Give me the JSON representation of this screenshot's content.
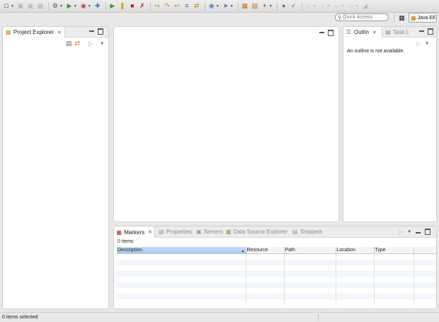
{
  "toolbar": {
    "quick_access_placeholder": "Quick Access",
    "perspective_label": "Java EE"
  },
  "project_explorer": {
    "tab_label": "Project Explorer"
  },
  "outline": {
    "tab_label": "Outlin",
    "task_tab_label": "Task L",
    "message": "An outline is not available."
  },
  "bottom": {
    "tabs": [
      {
        "label": "Markers",
        "icon": "markers-icon"
      },
      {
        "label": "Properties",
        "icon": "properties-icon"
      },
      {
        "label": "Servers",
        "icon": "servers-icon"
      },
      {
        "label": "Data Source Explorer",
        "icon": "data-source-icon"
      },
      {
        "label": "Snippets",
        "icon": "snippets-icon"
      }
    ],
    "item_count": "0 items",
    "columns": [
      "Description",
      "Resource",
      "Path",
      "Location",
      "Type"
    ]
  },
  "status": {
    "text": "0 items selected"
  },
  "colors": {
    "accent": "#a9c8ef",
    "run": "#2e9e2e",
    "stop": "#d42020"
  }
}
